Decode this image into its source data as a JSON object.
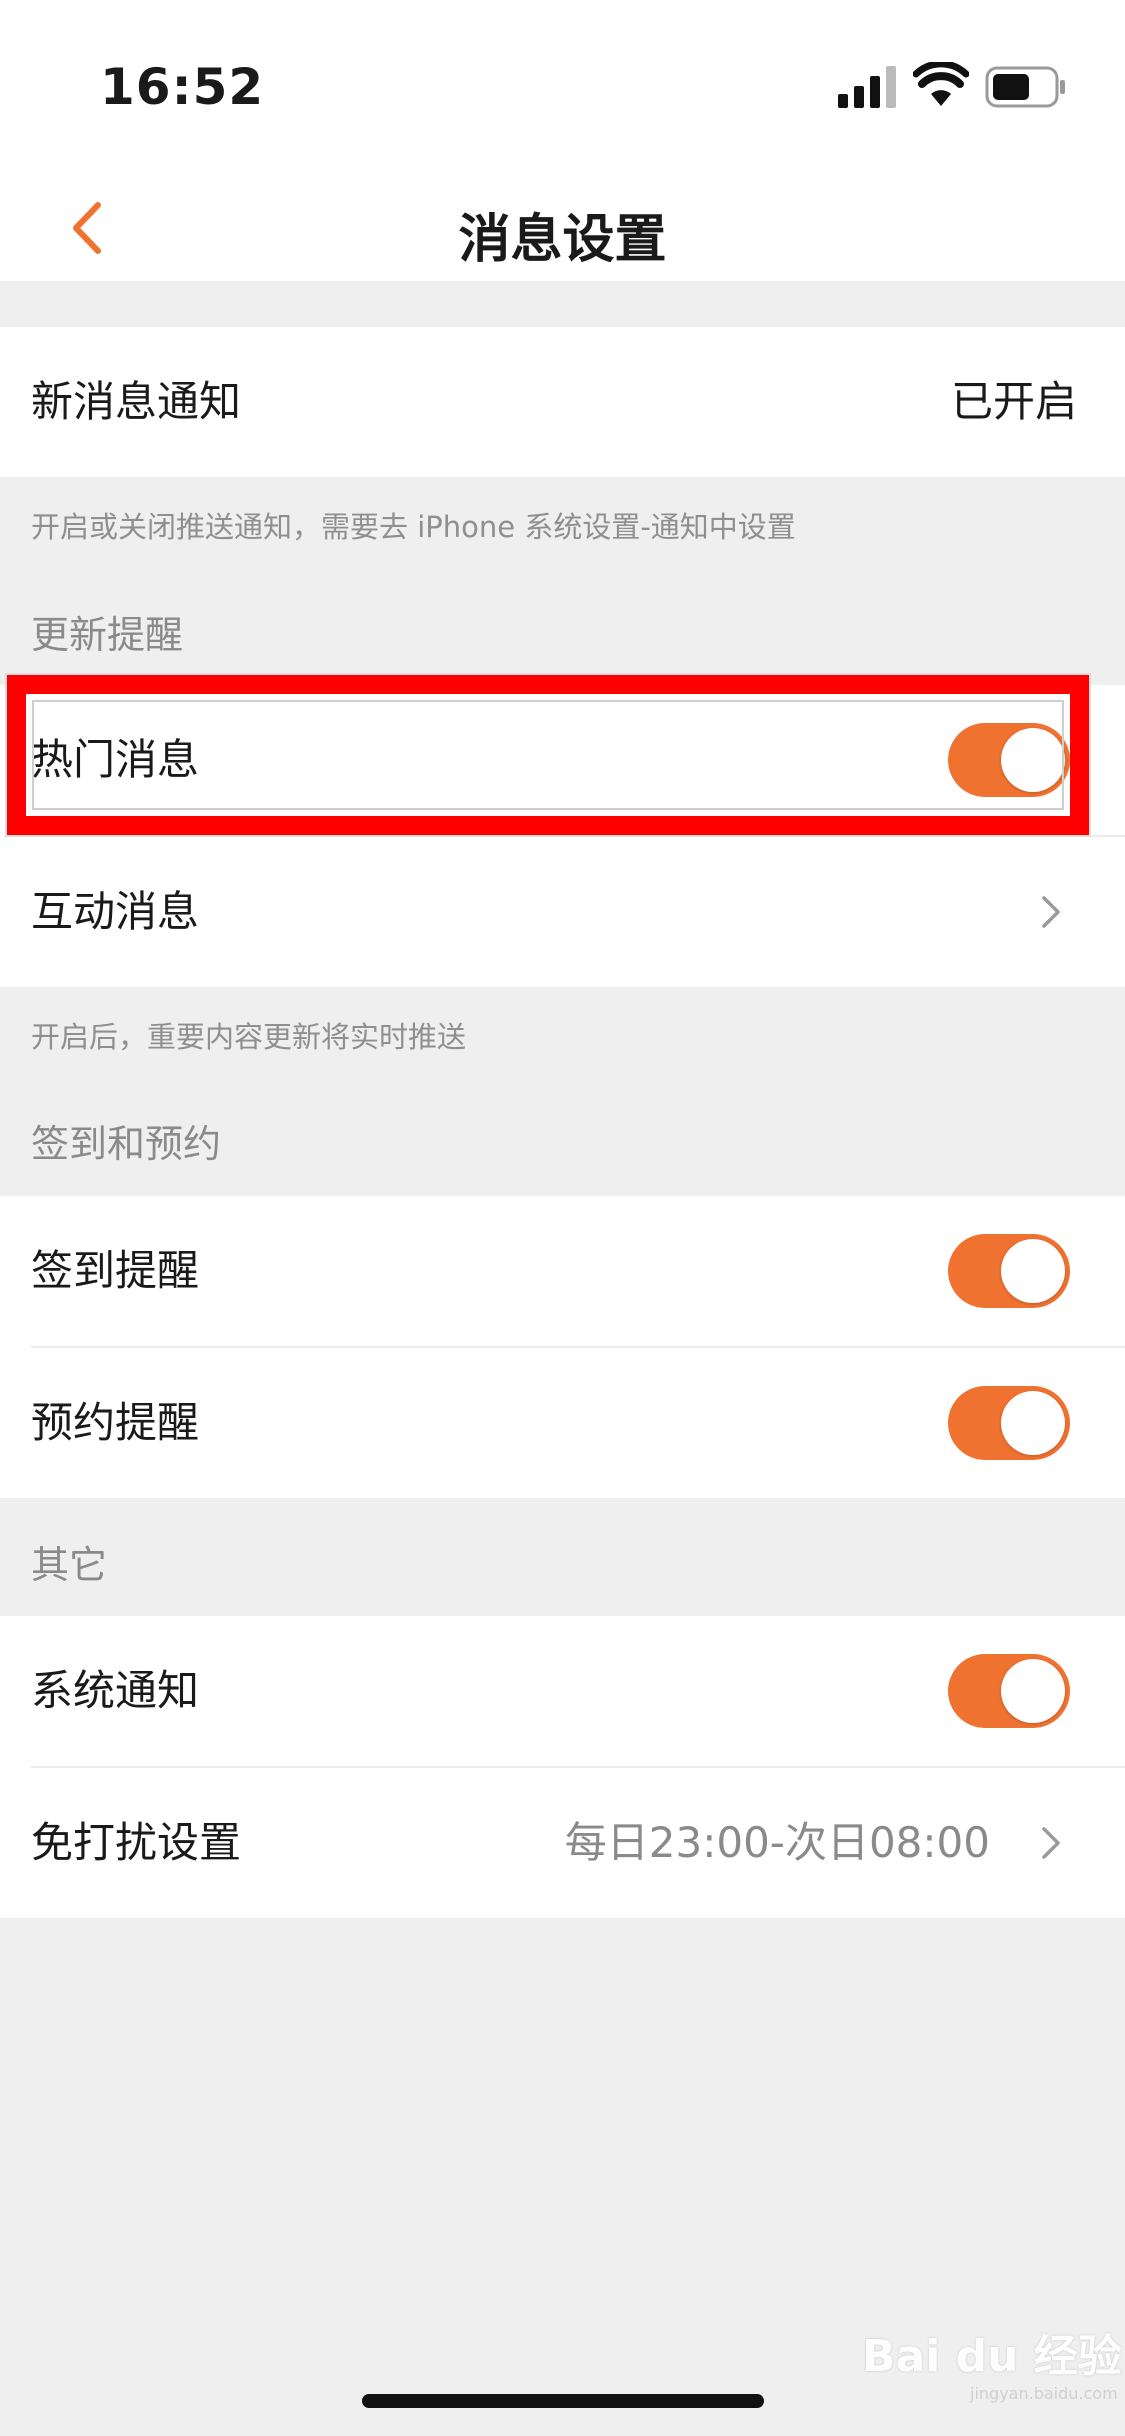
{
  "status_bar": {
    "time": "16:52"
  },
  "nav": {
    "title": "消息设置"
  },
  "new_message": {
    "label": "新消息通知",
    "value": "已开启",
    "note": "开启或关闭推送通知，需要去 iPhone 系统设置-通知中设置"
  },
  "update_reminder": {
    "header": "更新提醒",
    "items": [
      {
        "label": "热门消息",
        "toggle": true
      },
      {
        "label": "互动消息"
      }
    ],
    "note": "开启后，重要内容更新将实时推送"
  },
  "checkin_booking": {
    "header": "签到和预约",
    "items": [
      {
        "label": "签到提醒",
        "toggle": true
      },
      {
        "label": "预约提醒",
        "toggle": true
      }
    ]
  },
  "other": {
    "header": "其它",
    "items": [
      {
        "label": "系统通知",
        "toggle": true
      },
      {
        "label": "免打扰设置",
        "value": "每日23:00-次日08:00"
      }
    ]
  },
  "watermark": {
    "brand": "Bai du 经验",
    "sub": "jingyan.baidu.com"
  },
  "colors": {
    "accent": "#f07230",
    "highlight": "#ff0000",
    "background": "#efefef"
  }
}
